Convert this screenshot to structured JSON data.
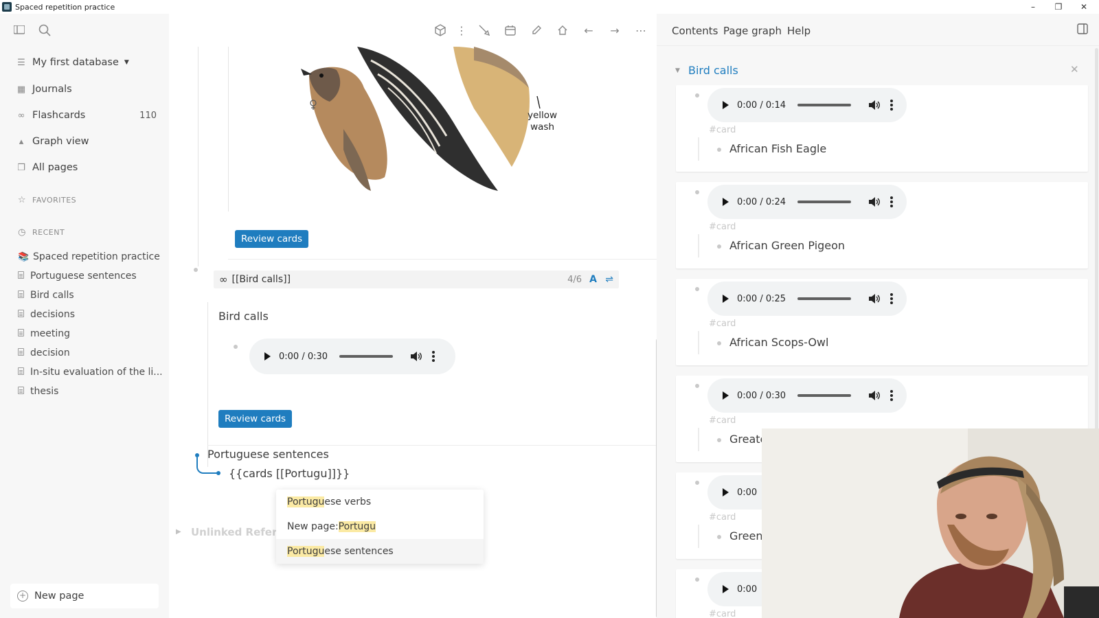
{
  "window": {
    "title": "Spaced repetition practice",
    "controls": [
      "minimize",
      "restore",
      "close"
    ]
  },
  "sidebar": {
    "database_label": "My first database",
    "nav": [
      {
        "label": "Journals",
        "icon": "calendar-icon"
      },
      {
        "label": "Flashcards",
        "icon": "infinity-icon",
        "count": "110"
      },
      {
        "label": "Graph view",
        "icon": "graph-icon"
      },
      {
        "label": "All pages",
        "icon": "pages-icon"
      }
    ],
    "favorites_label": "FAVORITES",
    "recent_label": "RECENT",
    "recent": [
      "Spaced repetition practice",
      "Portuguese sentences",
      "Bird calls",
      "decisions",
      "meeting",
      "decision",
      "In-situ evaluation of the li...",
      "thesis"
    ],
    "new_page_label": "New page"
  },
  "toolbar": {
    "icons": [
      "cube-icon",
      "more-vertical-icon",
      "brush-icon",
      "calendar-icon",
      "edit-icon",
      "home-icon",
      "arrow-left-icon",
      "arrow-right-icon",
      "more-horizontal-icon"
    ]
  },
  "main": {
    "image_annotation": "yellow\nwash",
    "review_button_1": "Review cards",
    "cards_query": "[[Bird calls]]",
    "cards_count": "4/6",
    "cards_font_toggle": "A",
    "block_title": "Bird calls",
    "audio": {
      "time": "0:00 / 0:30"
    },
    "review_button_2": "Review cards",
    "portuguese_title": "Portuguese sentences",
    "editing_text": "{{cards [[Portugu]]}}",
    "linked_refs_label": "Unlinked Refere",
    "autocomplete": [
      {
        "highlight": "Portugu",
        "rest": "ese verbs",
        "prefix": ""
      },
      {
        "highlight": "Portugu",
        "rest": "",
        "prefix": "New page: "
      },
      {
        "highlight": "Portugu",
        "rest": "ese sentences",
        "prefix": ""
      }
    ]
  },
  "right_panel": {
    "tabs": [
      "Contents",
      "Page graph",
      "Help"
    ],
    "page_title": "Bird calls",
    "card_tag": "#card",
    "cards": [
      {
        "time": "0:00 / 0:14",
        "title": "African Fish Eagle"
      },
      {
        "time": "0:00 / 0:24",
        "title": "African Green Pigeon"
      },
      {
        "time": "0:00 / 0:25",
        "title": "African Scops-Owl"
      },
      {
        "time": "0:00 / 0:30",
        "title": "Greate"
      },
      {
        "time": "0:00",
        "title": "Green"
      },
      {
        "time": "0:00",
        "title": ""
      }
    ]
  },
  "colors": {
    "accent": "#1f7dbf",
    "highlight": "#fbeaa4",
    "sidebar_bg": "#f7f7f7"
  }
}
